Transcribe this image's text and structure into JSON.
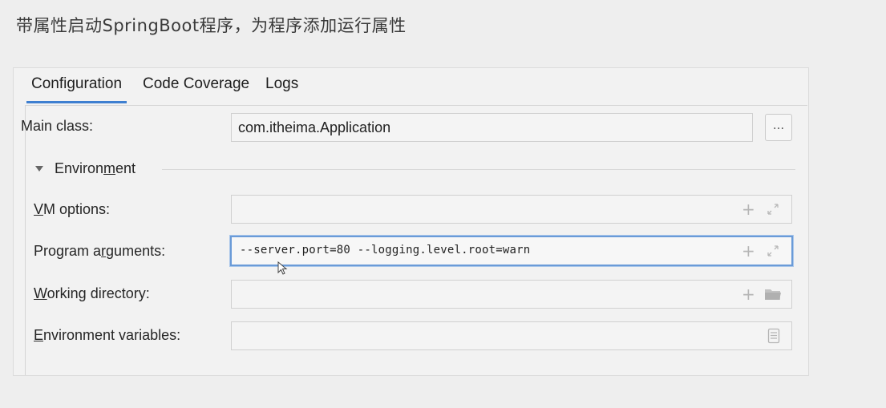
{
  "heading": "带属性启动SpringBoot程序，为程序添加运行属性",
  "tabs": [
    {
      "label": "Configuration",
      "active": true
    },
    {
      "label": "Code Coverage",
      "active": false
    },
    {
      "label": "Logs",
      "active": false
    }
  ],
  "main_class": {
    "label": "Main class:",
    "value": "com.itheima.Application",
    "browse_label": "..."
  },
  "environment": {
    "label_pre": "Environ",
    "label_mnemonic": "m",
    "label_post": "ent",
    "expanded": true
  },
  "fields": {
    "vm_options": {
      "label_mnemonic": "V",
      "label_rest": "M options:",
      "value": ""
    },
    "program_arguments": {
      "label_pre": "Program a",
      "label_mnemonic": "r",
      "label_post": "guments:",
      "value": "--server.port=80 --logging.level.root=warn"
    },
    "working_directory": {
      "label_mnemonic": "W",
      "label_rest": "orking directory:",
      "value": ""
    },
    "environment_variables": {
      "label_mnemonic": "E",
      "label_rest": "nvironment variables:",
      "value": ""
    }
  },
  "icons": {
    "plus": "+",
    "expand": "expand-icon",
    "folder": "folder-icon",
    "document": "document-icon"
  },
  "colors": {
    "tab_underline": "#3e7fd0",
    "focus_border": "#6a9bd8"
  }
}
